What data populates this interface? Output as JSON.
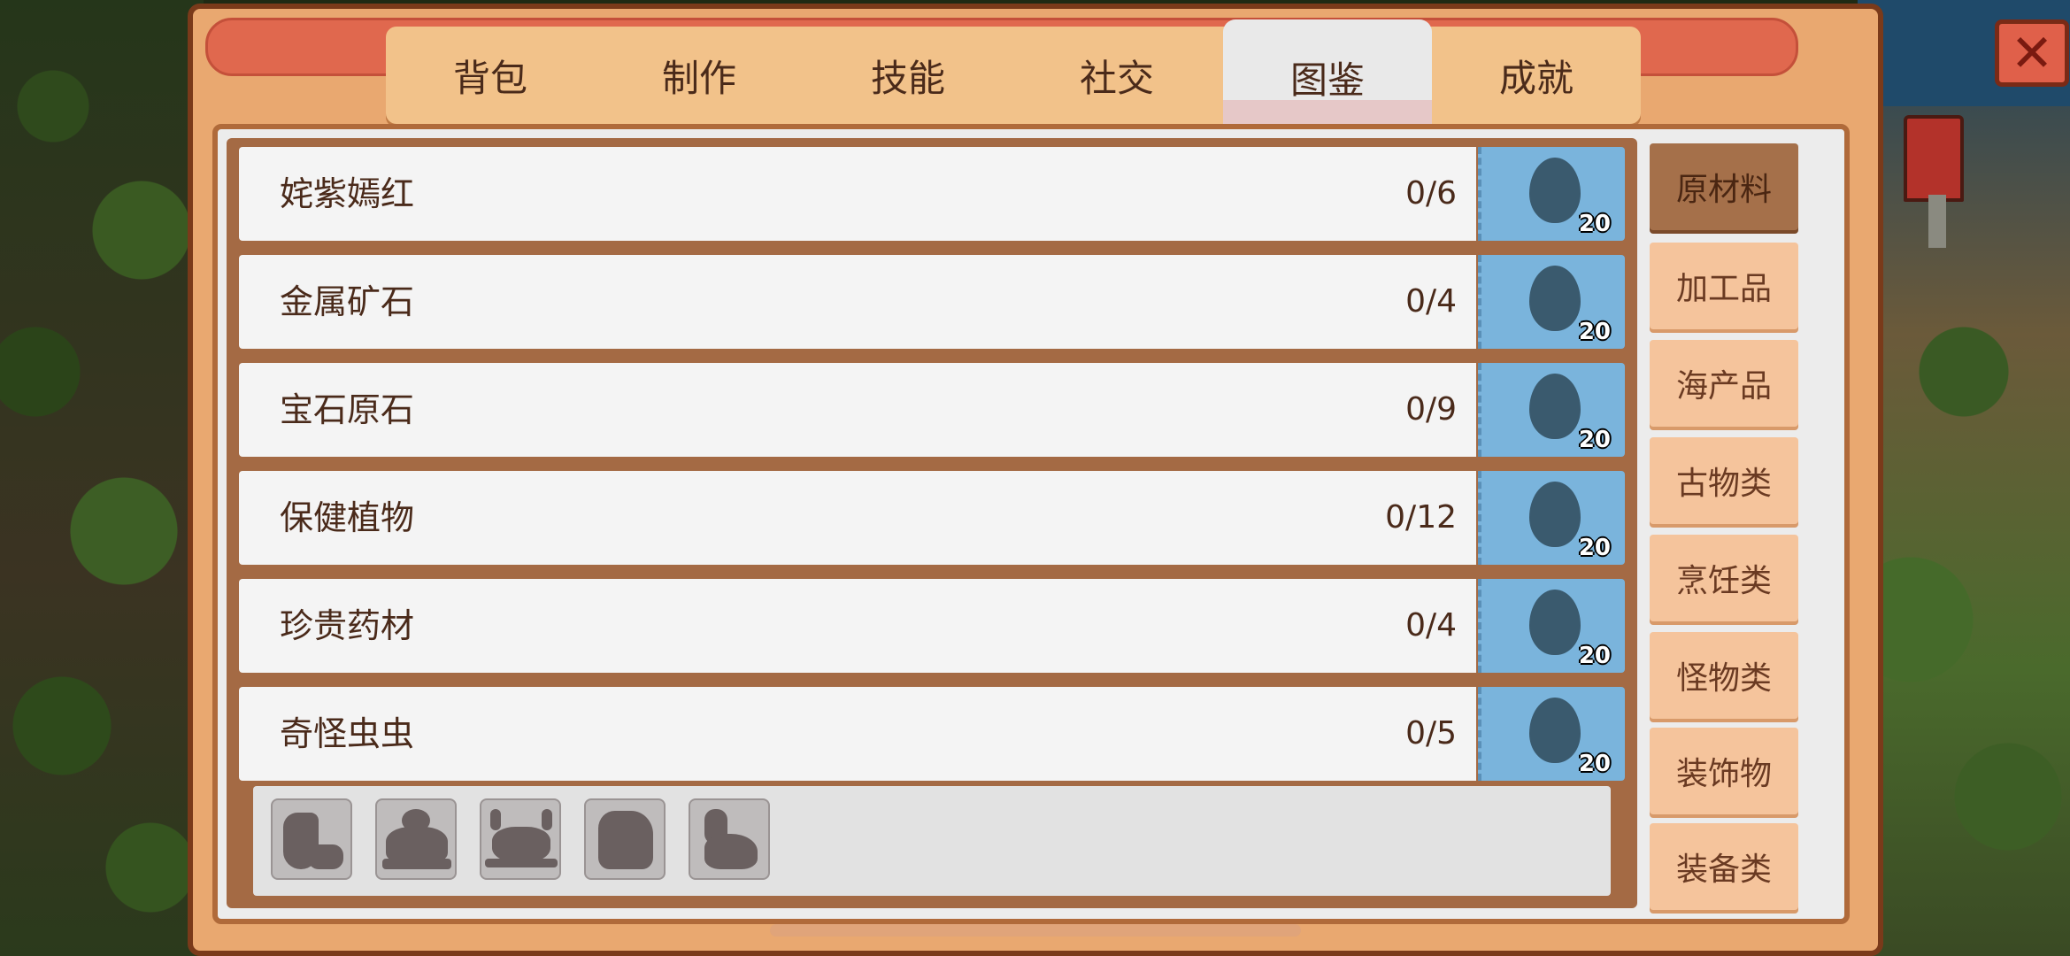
{
  "tabs": [
    {
      "label": "背包"
    },
    {
      "label": "制作"
    },
    {
      "label": "技能"
    },
    {
      "label": "社交"
    },
    {
      "label": "图鉴",
      "active": true
    },
    {
      "label": "成就"
    }
  ],
  "close_label": "✕",
  "collections": [
    {
      "label": "姹紫嫣红",
      "count": "0/6",
      "reward": "20"
    },
    {
      "label": "金属矿石",
      "count": "0/4",
      "reward": "20"
    },
    {
      "label": "宝石原石",
      "count": "0/9",
      "reward": "20"
    },
    {
      "label": "保健植物",
      "count": "0/12",
      "reward": "20"
    },
    {
      "label": "珍贵药材",
      "count": "0/4",
      "reward": "20"
    },
    {
      "label": "奇怪虫虫",
      "count": "0/5",
      "reward": "20"
    }
  ],
  "bug_slots": [
    "grub-silhouette-icon",
    "beetle-silhouette-icon",
    "crab-silhouette-icon",
    "bug-silhouette-icon",
    "snail-silhouette-icon"
  ],
  "categories": [
    {
      "label": "原材料",
      "active": true
    },
    {
      "label": "加工品"
    },
    {
      "label": "海产品"
    },
    {
      "label": "古物类"
    },
    {
      "label": "烹饪类"
    },
    {
      "label": "怪物类"
    },
    {
      "label": "装饰物"
    },
    {
      "label": "装备类"
    }
  ],
  "colors": {
    "window": "#e9a870",
    "tab_active": "#e9e9e9",
    "category_active": "#a5704a",
    "icon_bg": "#7ab4dc"
  }
}
